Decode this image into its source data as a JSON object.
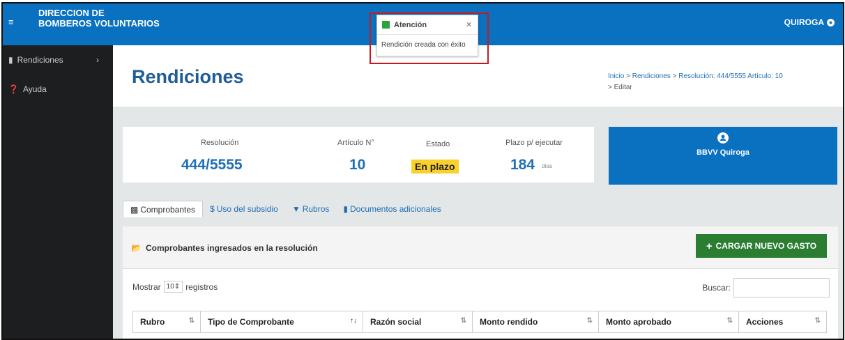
{
  "app": {
    "brand_line1": "DIRECCION DE",
    "brand_line2": "BOMBEROS VOLUNTARIOS",
    "user": "QUIROGA"
  },
  "sidebar": {
    "items": [
      {
        "label": "Rendiciones",
        "icon": "document-icon"
      },
      {
        "label": "Ayuda",
        "icon": "help-icon"
      }
    ]
  },
  "page": {
    "title": "Rendiciones"
  },
  "breadcrumb": {
    "inicio": "Inicio",
    "sep": ">",
    "rendiciones": "Rendiciones",
    "resolucion": "Resolución: 444/5555 Artículo: 10",
    "editar": "Editar"
  },
  "stats": {
    "resolucion_label": "Resolución",
    "resolucion_value": "444/5555",
    "articulo_label": "Artículo N°",
    "articulo_value": "10",
    "estado_label": "Estado",
    "estado_value": "En plazo",
    "plazo_label": "Plazo p/ ejecutar",
    "plazo_value": "184",
    "plazo_unit": "días"
  },
  "org_card": {
    "name": "BBVV Quiroga",
    "icon": "users-icon"
  },
  "tabs": [
    {
      "label": "Comprobantes",
      "icon": "receipt-icon"
    },
    {
      "label": "Uso del subsidio",
      "icon": "dollar-icon"
    },
    {
      "label": "Rubros",
      "icon": "filter-icon"
    },
    {
      "label": "Documentos adicionales",
      "icon": "file-icon"
    }
  ],
  "panel": {
    "title": "Comprobantes ingresados en la resolución",
    "add_button": "CARGAR NUEVO GASTO",
    "show_label": "Mostrar",
    "show_value": "10",
    "registros_label": "registros",
    "search_label": "Buscar:"
  },
  "table": {
    "columns": [
      "Rubro",
      "Tipo de Comprobante",
      "Razón social",
      "Monto rendido",
      "Monto aprobado",
      "Acciones"
    ]
  },
  "toast": {
    "title": "Atención",
    "message": "Rendición creada con éxito",
    "color": "#2aa43c"
  },
  "colors": {
    "primary": "#0a70c0",
    "sidebar": "#1d1e20",
    "success": "#2a7d31",
    "badge": "#f9d12a",
    "highlight": "#c8181e"
  }
}
